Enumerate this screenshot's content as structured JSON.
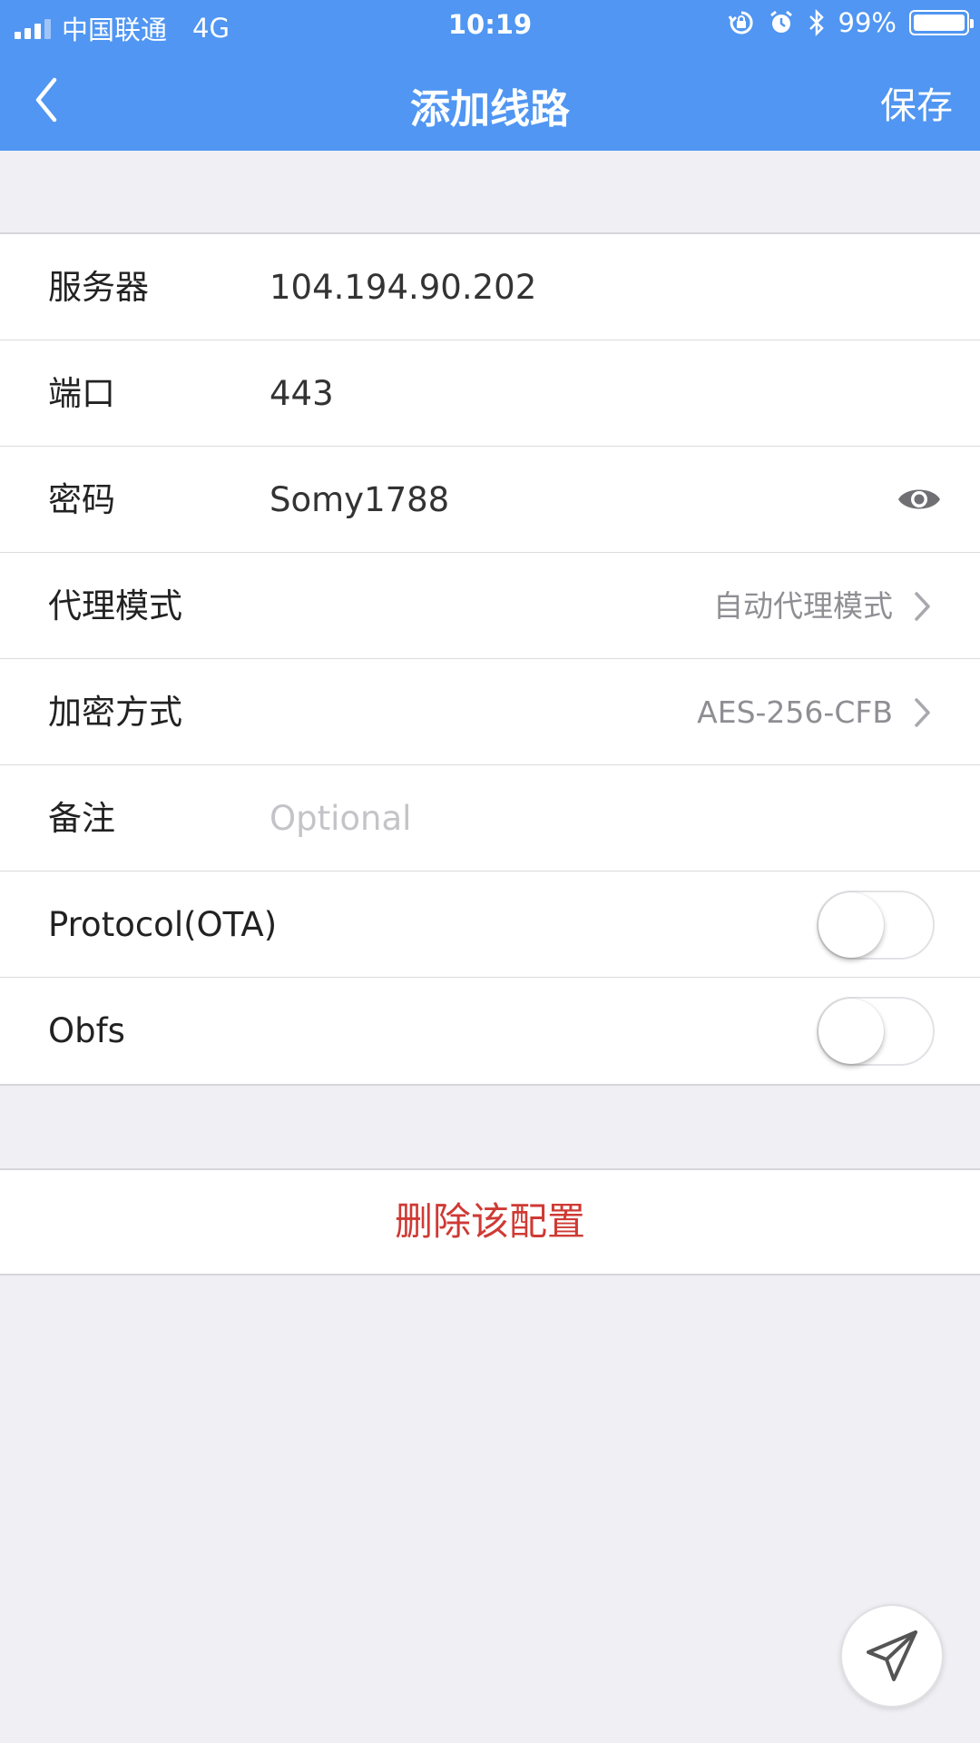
{
  "status_bar": {
    "carrier": "中国联通",
    "network": "4G",
    "time": "10:19",
    "battery": "99%"
  },
  "nav": {
    "title": "添加线路",
    "save_label": "保存"
  },
  "form": {
    "server_label": "服务器",
    "server_value": "104.194.90.202",
    "port_label": "端口",
    "port_value": "443",
    "password_label": "密码",
    "password_value": "Somy1788",
    "proxy_mode_label": "代理模式",
    "proxy_mode_value": "自动代理模式",
    "encryption_label": "加密方式",
    "encryption_value": "AES-256-CFB",
    "remark_label": "备注",
    "remark_placeholder": "Optional",
    "protocol_label": "Protocol(OTA)",
    "protocol_enabled": false,
    "obfs_label": "Obfs",
    "obfs_enabled": false
  },
  "delete_label": "删除该配置",
  "colors": {
    "header_bg": "#5096f2",
    "page_bg": "#efeff4",
    "delete_text": "#cf3a34",
    "secondary_text": "#8e8e93"
  },
  "icons": [
    "back-arrow-icon",
    "eye-icon",
    "chevron-right-icon",
    "send-icon",
    "alarm-icon",
    "bluetooth-icon",
    "rotation-lock-icon"
  ]
}
